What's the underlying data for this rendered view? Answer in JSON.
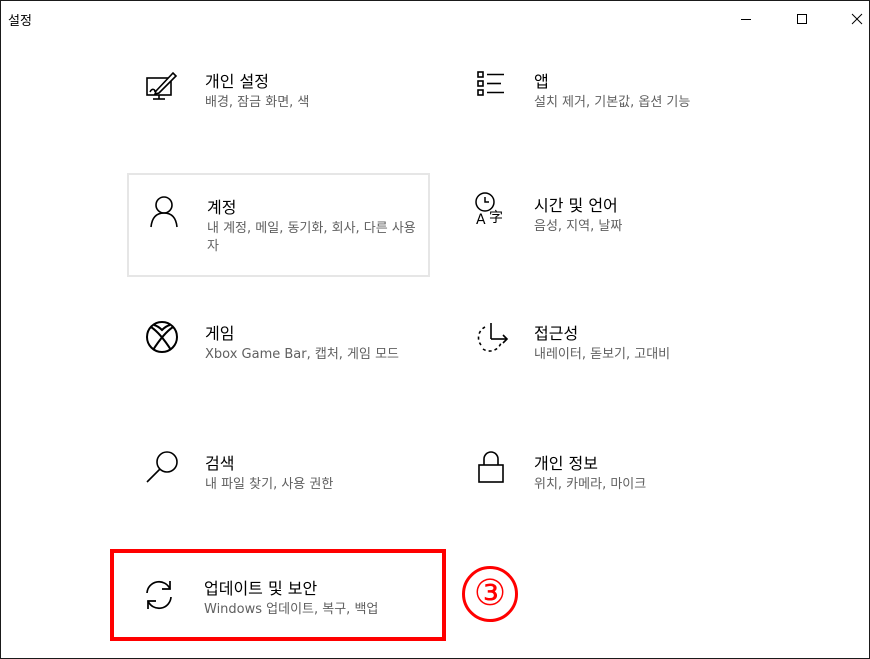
{
  "window": {
    "title": "설정",
    "controls": {
      "minimize": "minimize-icon",
      "maximize": "maximize-icon",
      "close": "close-icon"
    }
  },
  "tiles": {
    "personalization": {
      "title": "개인 설정",
      "desc": "배경, 잠금 화면, 색",
      "icon": "personalization-icon"
    },
    "apps": {
      "title": "앱",
      "desc": "설치 제거, 기본값, 옵션 기능",
      "icon": "apps-icon"
    },
    "accounts": {
      "title": "계정",
      "desc": "내 계정, 메일, 동기화, 회사, 다른 사용자",
      "icon": "person-icon"
    },
    "time_language": {
      "title": "시간 및 언어",
      "desc": "음성, 지역, 날짜",
      "icon": "time-language-icon"
    },
    "gaming": {
      "title": "게임",
      "desc": "Xbox Game Bar, 캡처, 게임 모드",
      "icon": "xbox-icon"
    },
    "ease_of_access": {
      "title": "접근성",
      "desc": "내레이터, 돋보기, 고대비",
      "icon": "ease-of-access-icon"
    },
    "search": {
      "title": "검색",
      "desc": "내 파일 찾기, 사용 권한",
      "icon": "search-icon"
    },
    "privacy": {
      "title": "개인 정보",
      "desc": "위치, 카메라, 마이크",
      "icon": "lock-icon"
    },
    "update_security": {
      "title": "업데이트 및 보안",
      "desc": "Windows 업데이트, 복구, 백업",
      "icon": "sync-icon"
    }
  },
  "annotation": {
    "label": "③",
    "color": "#ff0000"
  },
  "colors": {
    "title_text": "#000000",
    "desc_text": "#606060",
    "highlight_border": "#ff0000",
    "hover_border": "#e6e6e6"
  }
}
